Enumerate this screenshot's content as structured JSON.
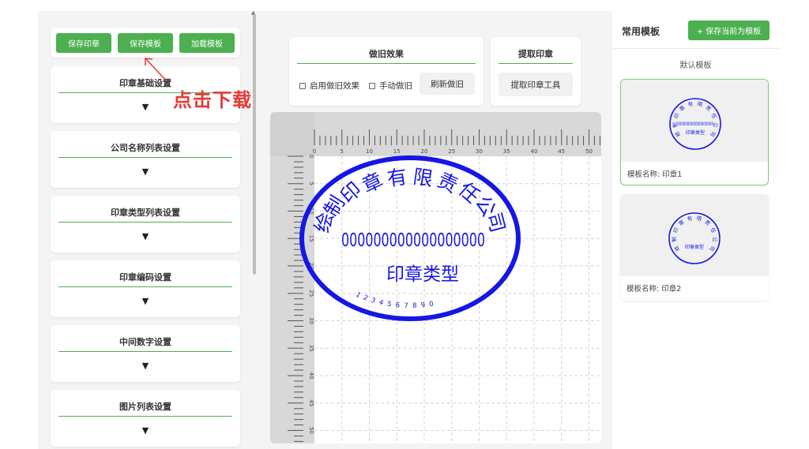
{
  "left": {
    "buttons": {
      "save_stamp": "保存印章",
      "save_template": "保存模板",
      "load_template": "加载模板"
    },
    "sections": [
      {
        "title": "印章基础设置",
        "arrow": "▼"
      },
      {
        "title": "公司名称列表设置",
        "arrow": "▼"
      },
      {
        "title": "印章类型列表设置",
        "arrow": "▼"
      },
      {
        "title": "印章编码设置",
        "arrow": "▼"
      },
      {
        "title": "中间数字设置",
        "arrow": "▼"
      },
      {
        "title": "图片列表设置",
        "arrow": "▼"
      }
    ]
  },
  "aging": {
    "title": "做旧效果",
    "enable": "启用做旧效果",
    "manual": "手动做旧",
    "refresh": "刷新做旧"
  },
  "extract": {
    "title": "提取印章",
    "tool": "提取印章工具"
  },
  "annotation": "点击下载",
  "stamp": {
    "company_chars": [
      "绘",
      "制",
      "印",
      "章",
      "有",
      "限",
      "责",
      "任",
      "公",
      "司"
    ],
    "company_name": "绘制印章有限责任公司",
    "middle_number": "000000000000000000",
    "type": "印章类型",
    "code": "1234567890",
    "color": "#1616e6"
  },
  "ruler": {
    "top_ticks": [
      "0",
      "5",
      "10",
      "15",
      "20",
      "25",
      "30",
      "35",
      "40",
      "45",
      "50"
    ],
    "left_ticks": [
      "0",
      "5",
      "10",
      "15",
      "20",
      "25",
      "30",
      "35",
      "40",
      "45",
      "50"
    ]
  },
  "right": {
    "title": "常用模板",
    "save_current": "+ 保存当前为模板",
    "default_label": "默认模板",
    "templates": [
      {
        "name": "模板名称: 印章1",
        "number": "000000000000000000",
        "type": "印章类型",
        "company": "绘制印章有限责任公司"
      },
      {
        "name": "模板名称: 印章2",
        "type": "印章类型",
        "company": "绘制印章有限责任公司"
      }
    ]
  },
  "colors": {
    "accent": "#4caf50",
    "annotation": "#e53935",
    "stamp": "#1616e6"
  }
}
